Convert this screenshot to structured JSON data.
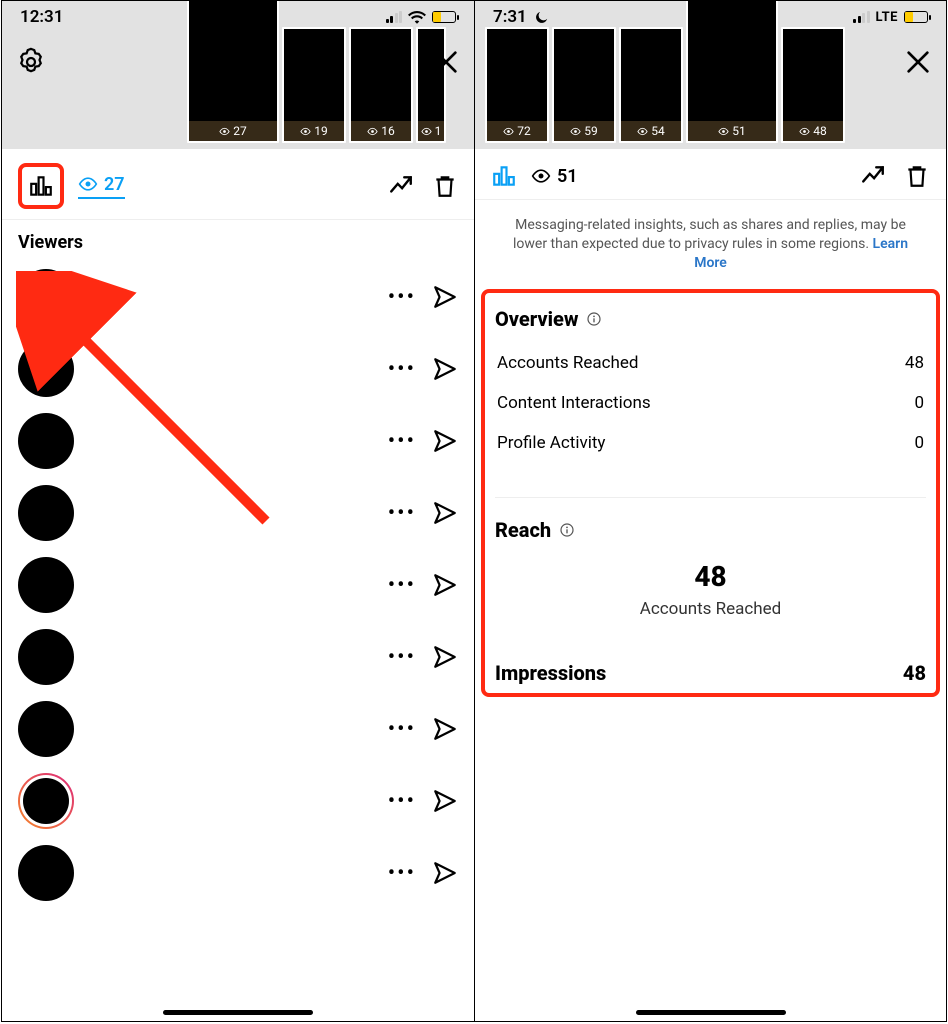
{
  "left": {
    "status": {
      "time": "12:31",
      "net": "wifi"
    },
    "story_views": [
      "27",
      "19",
      "16",
      "1"
    ],
    "selected_story_index": 0,
    "midbar": {
      "count": "27"
    },
    "viewers_title": "Viewers",
    "viewer_count": 9
  },
  "right": {
    "status": {
      "time": "7:31",
      "net_label": "LTE"
    },
    "story_views": [
      "72",
      "59",
      "54",
      "51",
      "48"
    ],
    "selected_story_index": 3,
    "midbar": {
      "count": "51"
    },
    "note_prefix": "Messaging-related insights, such as shares and replies, may be lower than expected due to privacy rules in some regions. ",
    "note_link": "Learn More",
    "overview": {
      "title": "Overview",
      "rows": [
        {
          "label": "Accounts Reached",
          "value": "48"
        },
        {
          "label": "Content Interactions",
          "value": "0"
        },
        {
          "label": "Profile Activity",
          "value": "0"
        }
      ]
    },
    "reach": {
      "title": "Reach",
      "value": "48",
      "subtitle": "Accounts Reached"
    },
    "impressions": {
      "label": "Impressions",
      "value": "48"
    }
  }
}
